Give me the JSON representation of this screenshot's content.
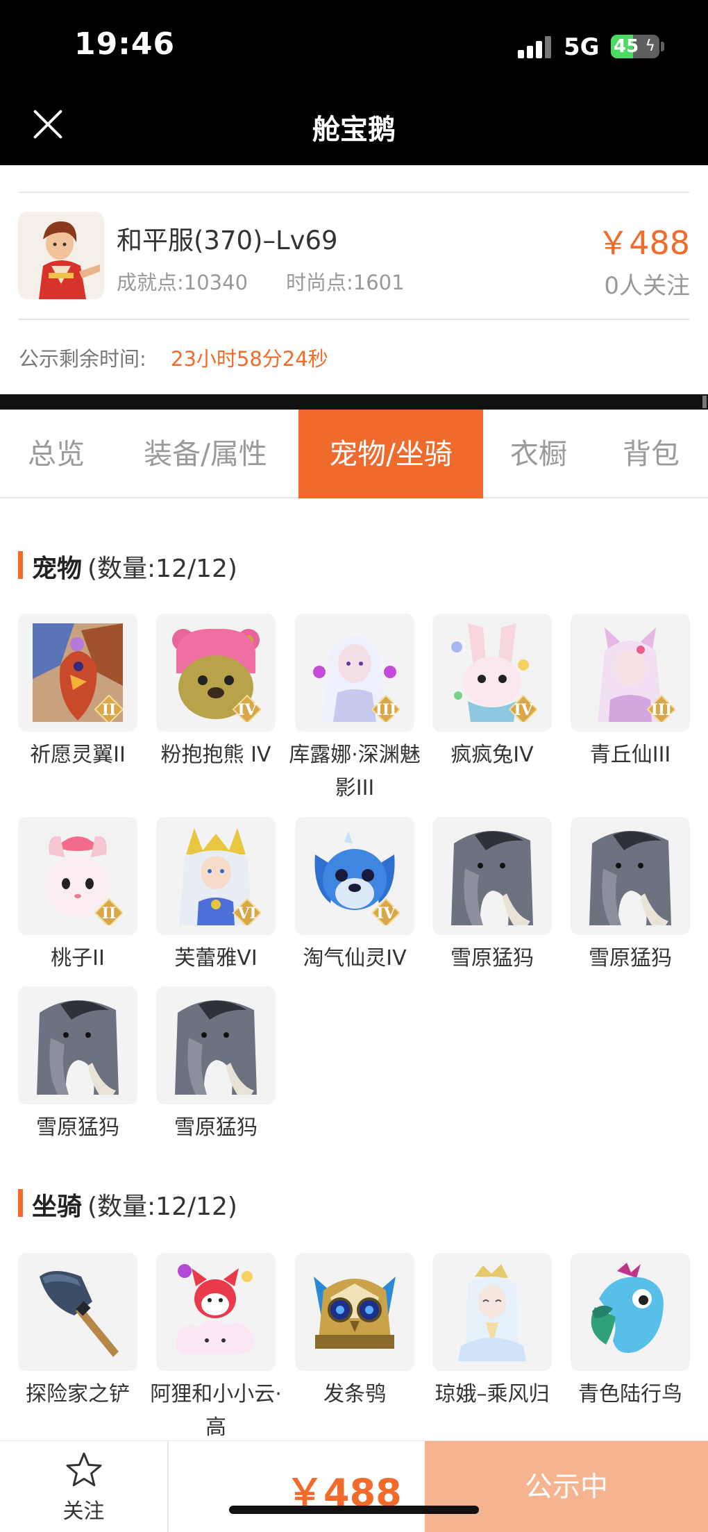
{
  "status_bar": {
    "time": "19:46",
    "network": "5G",
    "battery": "45",
    "battery_level_pct": 45
  },
  "nav": {
    "title": "舱宝鹅"
  },
  "product": {
    "title": "和平服(370)–Lv69",
    "achievement": "成就点:10340",
    "fashion": "时尚点:1601",
    "price": "￥488",
    "followers": "0人关注"
  },
  "countdown": {
    "label": "公示剩余时间:",
    "value": "23小时58分24秒"
  },
  "tabs": [
    {
      "label": "总览"
    },
    {
      "label": "装备/属性"
    },
    {
      "label": "宠物/坐骑"
    },
    {
      "label": "衣橱"
    },
    {
      "label": "背包"
    }
  ],
  "active_tab": "宠物/坐骑",
  "pets": {
    "title": "宠物",
    "count": "(数量:12/12)",
    "items": [
      {
        "name": "祈愿灵翼II",
        "icon": "phoenix-pet-icon",
        "grade": "II"
      },
      {
        "name": "粉抱抱熊 IV",
        "icon": "bear-pet-icon",
        "grade": "IV"
      },
      {
        "name": "库露娜·深渊魅影III",
        "icon": "fairy-pet-icon",
        "grade": "III"
      },
      {
        "name": "疯疯兔IV",
        "icon": "rabbit-pet-icon",
        "grade": "IV"
      },
      {
        "name": "青丘仙III",
        "icon": "fox-fairy-pet-icon",
        "grade": "III"
      },
      {
        "name": "桃子II",
        "icon": "cat-pet-icon",
        "grade": "II"
      },
      {
        "name": "芙蕾雅VI",
        "icon": "goddess-pet-icon",
        "grade": "VI"
      },
      {
        "name": "淘气仙灵IV",
        "icon": "dog-pet-icon",
        "grade": "IV"
      },
      {
        "name": "雪原猛犸",
        "icon": "mammoth-pet-icon",
        "grade": ""
      },
      {
        "name": "雪原猛犸",
        "icon": "mammoth-pet-icon",
        "grade": ""
      },
      {
        "name": "雪原猛犸",
        "icon": "mammoth-pet-icon",
        "grade": ""
      },
      {
        "name": "雪原猛犸",
        "icon": "mammoth-pet-icon",
        "grade": ""
      }
    ]
  },
  "mounts": {
    "title": "坐骑",
    "count": "(数量:12/12)",
    "items": [
      {
        "name": "探险家之铲",
        "icon": "shovel-mount-icon"
      },
      {
        "name": "阿狸和小小云·高",
        "icon": "fox-cloud-mount-icon"
      },
      {
        "name": "发条鸮",
        "icon": "clockwork-owl-mount-icon"
      },
      {
        "name": "琼娥–乘风归",
        "icon": "moon-fairy-mount-icon"
      },
      {
        "name": "青色陆行鸟",
        "icon": "bird-mount-icon"
      }
    ]
  },
  "bottom_bar": {
    "follow_label": "关注",
    "price": "￥488",
    "status_label": "公示中"
  },
  "colors": {
    "accent": "#ee6a2d",
    "price": "#f26b2a",
    "status_button": "#f5b48f"
  }
}
